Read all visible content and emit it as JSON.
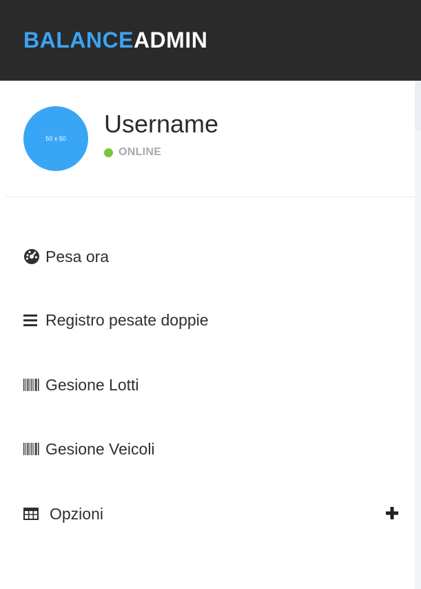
{
  "brand": {
    "part1": "BALANCE",
    "part2": "ADMIN"
  },
  "user": {
    "avatar_text": "50 x 50",
    "name": "Username",
    "status": "ONLINE"
  },
  "menu": {
    "items": [
      {
        "icon": "dashboard-icon",
        "label": "Pesa ora"
      },
      {
        "icon": "list-icon",
        "label": "Registro pesate doppie"
      },
      {
        "icon": "barcode-icon",
        "label": "Gesione Lotti"
      },
      {
        "icon": "barcode-icon",
        "label": "Gesione Veicoli"
      },
      {
        "icon": "table-icon",
        "label": "Opzioni",
        "expand_icon": "plus-icon"
      }
    ]
  },
  "colors": {
    "topbar": "#2a2a2a",
    "brand_accent": "#3aa4f3",
    "avatar": "#38a6f5",
    "online": "#7cc53a"
  }
}
